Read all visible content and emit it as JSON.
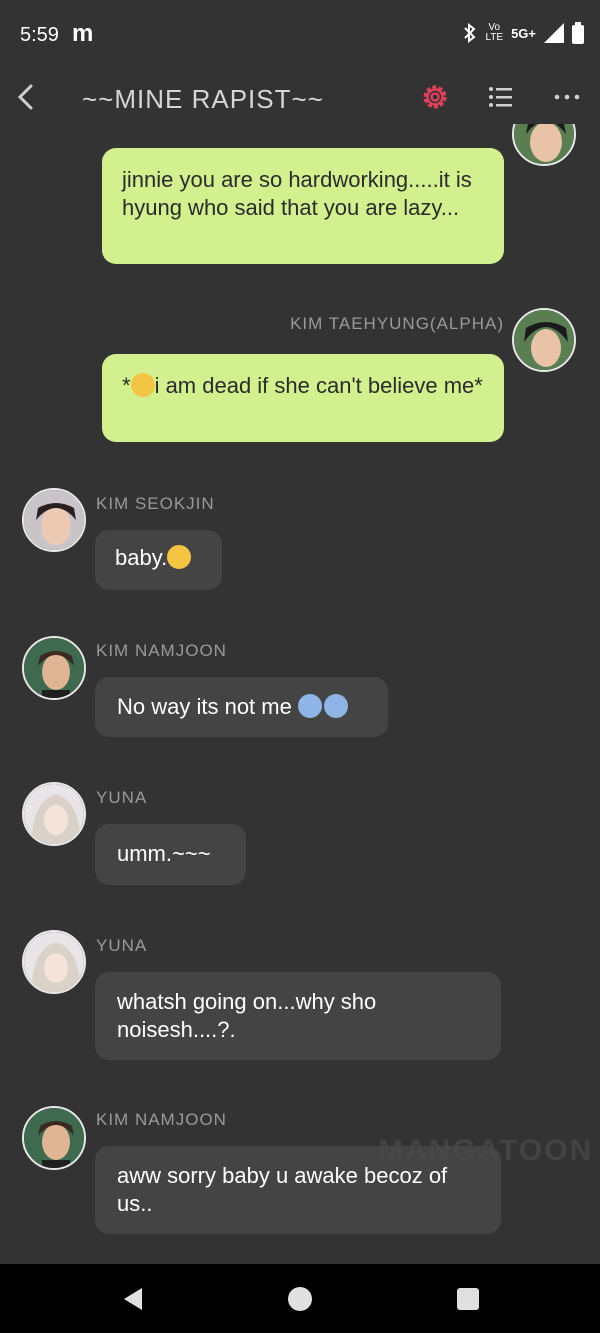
{
  "status": {
    "time": "5:59",
    "carrier_icon": "m",
    "volte": "Vo",
    "lte": "LTE",
    "network": "5G+"
  },
  "header": {
    "title": "~~MINE RAPIST~~"
  },
  "messages": [
    {
      "side": "right",
      "name": "",
      "text": "jinnie you are so hardworking.....it is hyung who said that you are lazy..."
    },
    {
      "side": "right",
      "name": "KIM TAEHYUNG(ALPHA)",
      "text": "i am dead if she can't believe me*",
      "prefix": "*"
    },
    {
      "side": "left",
      "name": "KIM SEOKJIN",
      "text": "baby."
    },
    {
      "side": "left",
      "name": "KIM NAMJOON",
      "text": "No way its not me"
    },
    {
      "side": "left",
      "name": "YUNA",
      "text": "umm.~~~"
    },
    {
      "side": "left",
      "name": "YUNA",
      "text": "whatsh going on...why sho noisesh....?."
    },
    {
      "side": "left",
      "name": "KIM NAMJOON",
      "text": "aww sorry baby u awake becoz of us.."
    }
  ],
  "watermark": "MANGATOON",
  "colors": {
    "background": "#333333",
    "own_bubble": "#d3f08f",
    "other_bubble": "#444444",
    "settings_accent": "#e0405a"
  },
  "icons": [
    "back-icon",
    "settings-icon",
    "list-icon",
    "more-icon",
    "bluetooth-icon",
    "signal-icon",
    "battery-icon",
    "nav-back-icon",
    "nav-home-icon",
    "nav-recents-icon"
  ]
}
